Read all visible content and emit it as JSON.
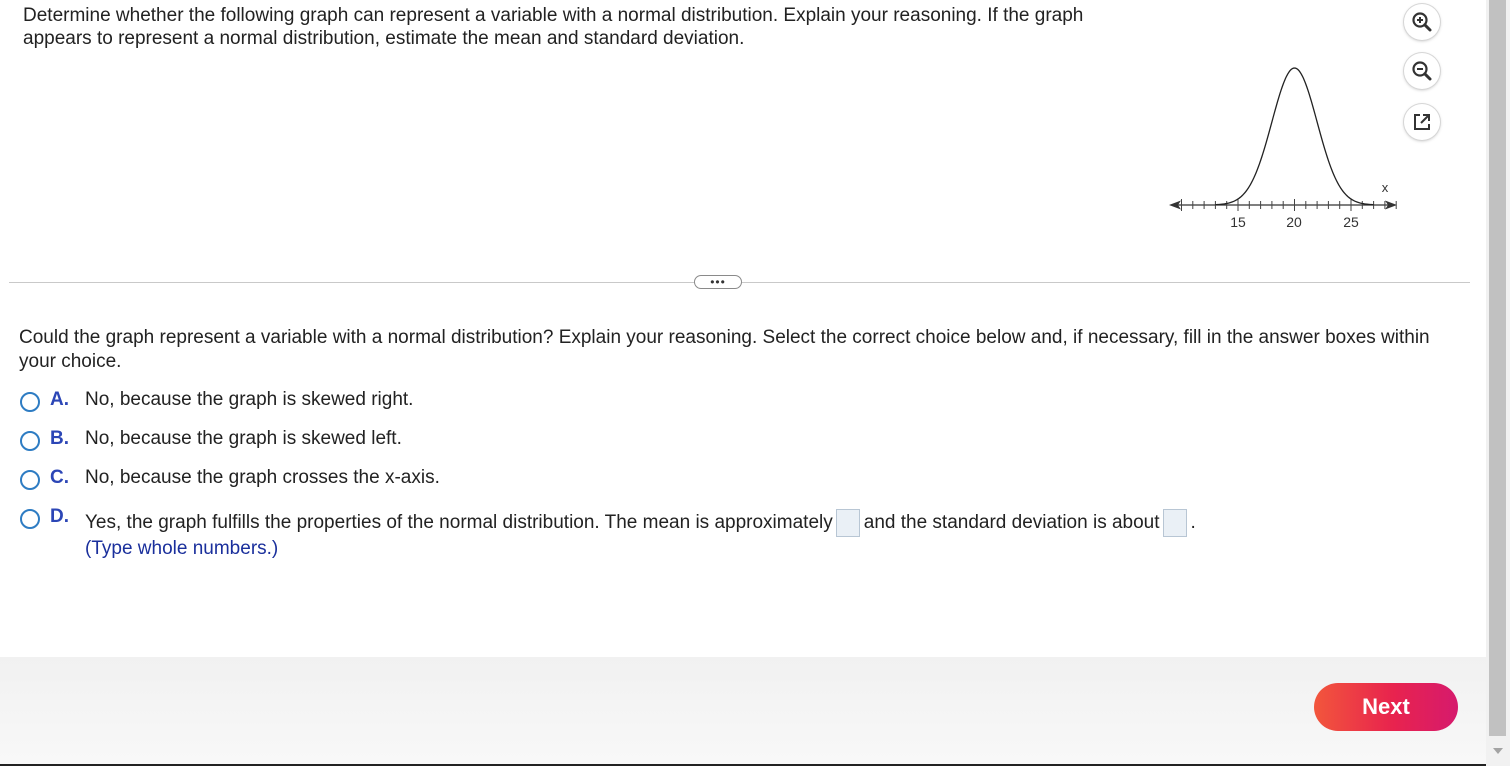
{
  "question": {
    "text": "Determine whether the following graph can represent a variable with a normal distribution. Explain your reasoning. If the graph appears to represent a normal distribution, estimate the mean and standard deviation."
  },
  "tools": {
    "zoom_in_icon": "zoom-in-icon",
    "zoom_out_icon": "zoom-out-icon",
    "popout_icon": "external-link-icon"
  },
  "graph": {
    "axis_label": "x",
    "ticks": [
      "15",
      "20",
      "25"
    ]
  },
  "more_button": {
    "label": "•••"
  },
  "prompt": {
    "text": "Could the graph represent a variable with a normal distribution? Explain your reasoning. Select the correct choice below and, if necessary, fill in the answer boxes within your choice."
  },
  "choices": [
    {
      "letter": "A.",
      "text": "No, because the graph is skewed right."
    },
    {
      "letter": "B.",
      "text": "No, because the graph is skewed left."
    },
    {
      "letter": "C.",
      "text": "No, because the graph crosses the x-axis."
    },
    {
      "letter": "D.",
      "text_before": "Yes, the graph fulfills the properties of the normal distribution. The mean is approximately",
      "text_middle": "and the standard deviation is about",
      "text_end": ".",
      "hint": "(Type whole numbers.)"
    }
  ],
  "footer": {
    "next_label": "Next"
  },
  "colors": {
    "accent": "#2c46b6",
    "radio": "#2e7cc3",
    "next_start": "#f2563c",
    "next_end": "#d61a6d"
  }
}
